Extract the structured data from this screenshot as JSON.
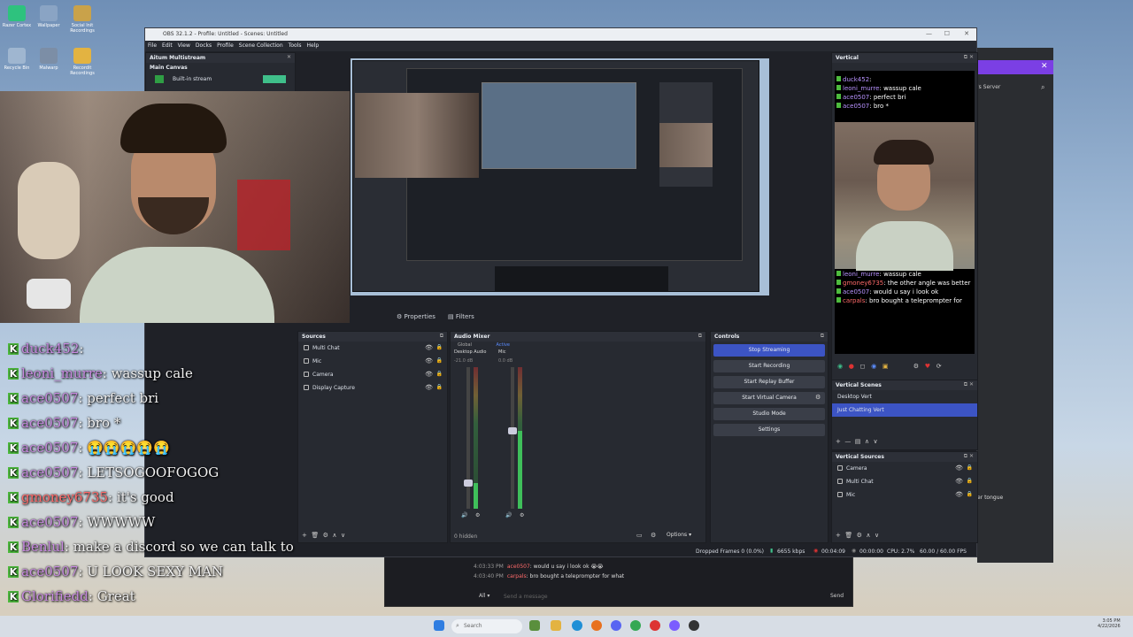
{
  "desktop": {
    "icons": [
      {
        "label": "Razer Cortex",
        "color": "#2ec27e"
      },
      {
        "label": "Wallpaper",
        "color": "#8aa4c4"
      },
      {
        "label": "Social Init Recordings",
        "color": "#c9a24a"
      },
      {
        "label": "Recycle Bin",
        "color": "#9fb6d0"
      },
      {
        "label": "Malwarp",
        "color": "#7c8ea6"
      },
      {
        "label": "Recordit Recordings",
        "color": "#e3b341"
      }
    ]
  },
  "obs": {
    "title": "OBS 32.1.2 - Profile: Untitled - Scenes: Untitled",
    "menu": [
      "File",
      "Edit",
      "View",
      "Docks",
      "Profile",
      "Scene Collection",
      "Tools",
      "Help"
    ],
    "multistream": {
      "title": "Aitum Multistream",
      "main_canvas": "Main Canvas",
      "builtin": "Built-in stream"
    },
    "preview_toolbar": {
      "properties": "Properties",
      "filters": "Filters"
    },
    "sources": {
      "title": "Sources",
      "items": [
        {
          "name": "Multi Chat",
          "icon": "browser-icon"
        },
        {
          "name": "Mic",
          "icon": "mic-icon"
        },
        {
          "name": "Camera",
          "icon": "camera-icon"
        },
        {
          "name": "Display Capture",
          "icon": "monitor-icon"
        }
      ]
    },
    "audio_mixer": {
      "title": "Audio Mixer",
      "tabs": [
        "Global",
        "Active"
      ],
      "channels": [
        {
          "name": "Desktop Audio",
          "db": "-21.0 dB",
          "level": 0.18
        },
        {
          "name": "Mic",
          "db": "0.0 dB",
          "level": 0.55
        }
      ],
      "hidden": "0 hidden",
      "options": "Options"
    },
    "controls": {
      "title": "Controls",
      "buttons": [
        "Stop Streaming",
        "Start Recording",
        "Start Replay Buffer",
        "Start Virtual Camera",
        "Studio Mode",
        "Settings"
      ]
    },
    "vertical": {
      "title": "Vertical",
      "chat_top": [
        {
          "user": "duck452",
          "msg": "",
          "color": "#b892ff"
        },
        {
          "user": "leoni_murre",
          "msg": "wassup cale",
          "color": "#b892ff"
        },
        {
          "user": "ace0507",
          "msg": "perfect bri",
          "color": "#b892ff"
        },
        {
          "user": "ace0507",
          "msg": "bro *",
          "color": "#b892ff"
        }
      ],
      "chat_bottom": [
        {
          "user": "leoni_murre",
          "msg": "wassup cale",
          "color": "#b892ff"
        },
        {
          "user": "gmoney6735",
          "msg": "the other angle was better",
          "color": "#ff6a6a"
        },
        {
          "user": "ace0507",
          "msg": "would u say i look ok",
          "color": "#b892ff"
        },
        {
          "user": "carpals",
          "msg": "bro bought a teleprompter for",
          "color": "#ff6a6a"
        }
      ],
      "scenes_title": "Vertical Scenes",
      "scenes": [
        "Desktop Vert",
        "Just Chatting Vert"
      ],
      "sources_title": "Vertical Sources",
      "sources": [
        {
          "name": "Camera",
          "icon": "camera-icon"
        },
        {
          "name": "Multi Chat",
          "icon": "browser-icon"
        },
        {
          "name": "Mic",
          "icon": "mic-icon"
        }
      ]
    },
    "status": {
      "dropped": "Dropped Frames 0 (0.0%)",
      "kbps": "6655 kbps",
      "live_time": "00:04:09",
      "rec_time": "00:00:00",
      "cpu": "CPU: 2.7%",
      "fps": "60.00 / 60.00 FPS"
    }
  },
  "overlay_chat": [
    {
      "user": "duck452",
      "msg": "",
      "cls": "u"
    },
    {
      "user": "leoni_murre",
      "msg": "wassup cale",
      "cls": "u"
    },
    {
      "user": "ace0507",
      "msg": "perfect bri",
      "cls": "u"
    },
    {
      "user": "ace0507",
      "msg": "bro *",
      "cls": "u"
    },
    {
      "user": "ace0507",
      "msg": "😭😭😭😭😭",
      "cls": "u"
    },
    {
      "user": "ace0507",
      "msg": "LETSOGOOFOGOG",
      "cls": "u"
    },
    {
      "user": "gmoney6735",
      "msg": "it's good",
      "cls": "u2"
    },
    {
      "user": "ace0507",
      "msg": "WWWWW",
      "cls": "u"
    },
    {
      "user": "Benlul",
      "msg": "make a discord so we can talk to",
      "cls": "u"
    },
    {
      "user": "ace0507",
      "msg": "U LOOK SEXY MAN",
      "cls": "u"
    },
    {
      "user": "Glorifiedd",
      "msg": "Great",
      "cls": "u"
    }
  ],
  "chat_window": {
    "lines": [
      {
        "time": "4:03:33 PM",
        "user": "ace0507",
        "msg": "would u say i look ok 😭😭"
      },
      {
        "time": "4:03:40 PM",
        "user": "carpals",
        "msg": "bro bought a teleprompter for what"
      }
    ],
    "filter": "All",
    "placeholder": "Send a message",
    "send": "Send"
  },
  "discord_side": {
    "server_label": "'s Server",
    "snippet": "er tongue"
  },
  "taskbar": {
    "search": "Search",
    "time": "3:05 PM",
    "date": "4/22/2026"
  }
}
